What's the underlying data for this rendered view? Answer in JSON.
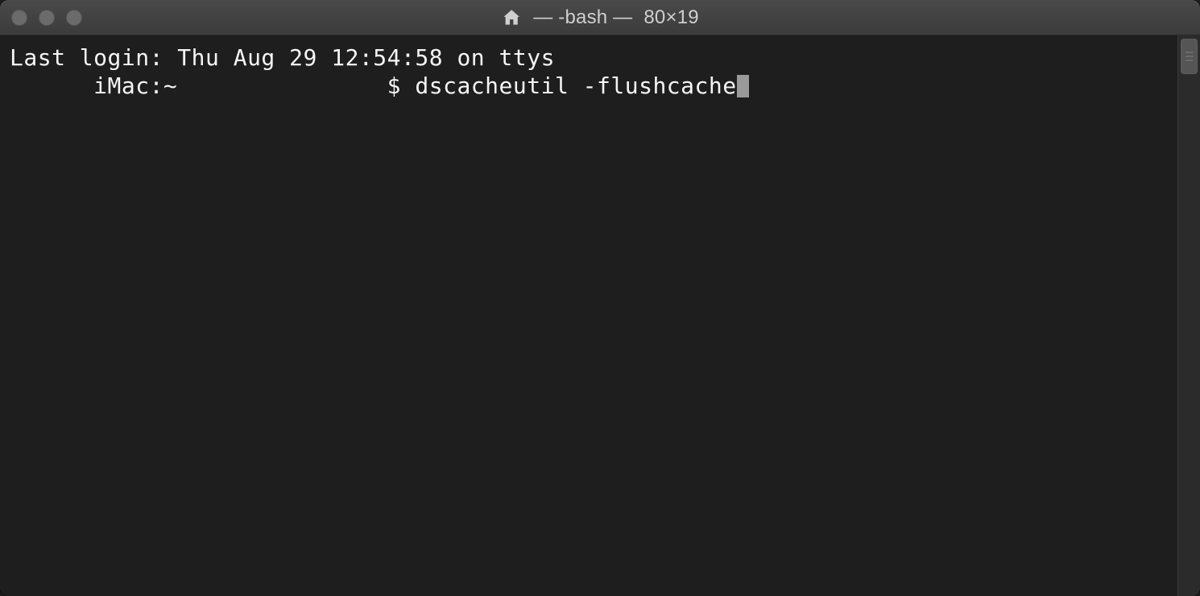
{
  "titlebar": {
    "title_prefix": "— -bash —",
    "title_size": "80×19"
  },
  "terminal": {
    "line1": "Last login: Thu Aug 29 12:54:58 on ttys",
    "line2_prefix": "      iMac:~               $ ",
    "line2_command": "dscacheutil -flushcache"
  }
}
